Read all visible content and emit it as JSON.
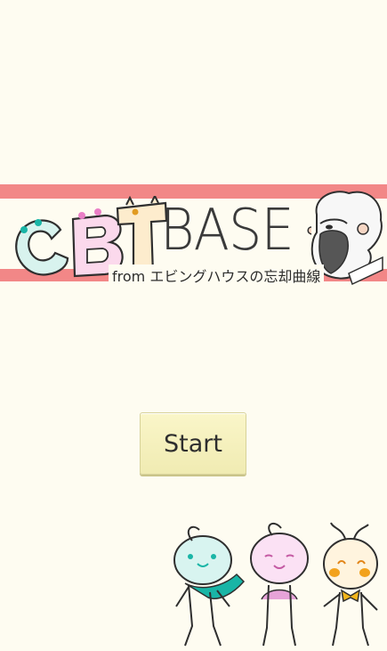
{
  "logo": {
    "letters": [
      "C",
      "B",
      "T"
    ],
    "base_text": "BASE",
    "subtitle": "from エビングハウスの忘却曲線",
    "colors": {
      "stripe": "#f28787",
      "c_letter": "#d8f3ee",
      "b_letter": "#fbd9ec",
      "t_letter": "#fdeccd",
      "outline": "#2f2f2f"
    },
    "mascot_icon": "old-man-with-beard-icon"
  },
  "start_button": {
    "label": "Start"
  },
  "characters": [
    {
      "name": "teal-character-icon",
      "color": "#19b5a6"
    },
    {
      "name": "pink-character-icon",
      "color": "#e6a3d8"
    },
    {
      "name": "orange-character-icon",
      "color": "#f2a21c"
    }
  ]
}
